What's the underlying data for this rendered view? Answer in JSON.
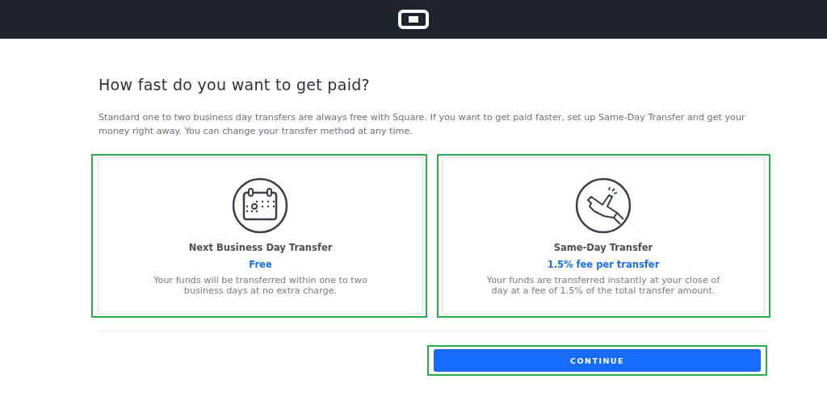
{
  "heading": "How fast do you want to get paid?",
  "intro": "Standard one to two business day transfers are always free with Square. If you want to get paid faster, set up Same-Day Transfer and get your money right away. You can change your transfer method at any time.",
  "options": [
    {
      "kind": "calendar",
      "title": "Next Business Day Transfer",
      "price": "Free",
      "description": "Your funds will be transferred within one to two business days at no extra charge."
    },
    {
      "kind": "hand",
      "title": "Same-Day Transfer",
      "price": "1.5% fee per transfer",
      "description": "Your funds are transferred instantly at your close of day at a fee of 1.5% of the total transfer amount."
    }
  ],
  "button": "CONTINUE"
}
